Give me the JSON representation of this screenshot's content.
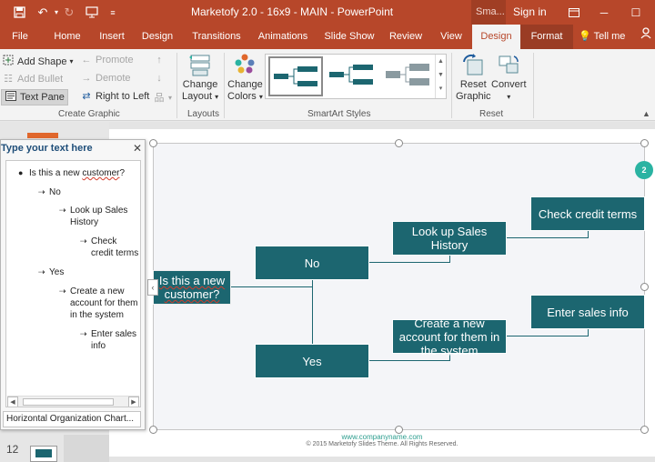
{
  "window": {
    "title": "Marketofy 2.0 - 16x9 - MAIN  -  PowerPoint",
    "context_tab_group": "Sma...",
    "sign_in": "Sign in"
  },
  "tabs": [
    {
      "label": "File"
    },
    {
      "label": "Home"
    },
    {
      "label": "Insert"
    },
    {
      "label": "Design"
    },
    {
      "label": "Transitions"
    },
    {
      "label": "Animations"
    },
    {
      "label": "Slide Show"
    },
    {
      "label": "Review"
    },
    {
      "label": "View"
    },
    {
      "label": "Design"
    },
    {
      "label": "Format"
    },
    {
      "label": "Tell me"
    }
  ],
  "ribbon": {
    "create_graphic": {
      "add_shape": "Add Shape",
      "add_bullet": "Add Bullet",
      "text_pane": "Text Pane",
      "promote": "Promote",
      "demote": "Demote",
      "right_to_left": "Right to Left",
      "label": "Create Graphic"
    },
    "layouts": {
      "change_layout_1": "Change",
      "change_layout_2": "Layout",
      "label": "Layouts"
    },
    "smartart_styles": {
      "change_colors_1": "Change",
      "change_colors_2": "Colors",
      "label": "SmartArt Styles"
    },
    "reset": {
      "reset_graphic_1": "Reset",
      "reset_graphic_2": "Graphic",
      "convert": "Convert",
      "label": "Reset"
    }
  },
  "text_pane": {
    "title": "Type your text here",
    "items": [
      {
        "level": 1,
        "text": "Is this a new customer?"
      },
      {
        "level": 2,
        "text": "No"
      },
      {
        "level": 3,
        "text": "Look up Sales History"
      },
      {
        "level": 4,
        "text": "Check credit terms"
      },
      {
        "level": 2,
        "text": "Yes"
      },
      {
        "level": 3,
        "text": "Create a new account for them in the system"
      },
      {
        "level": 4,
        "text": "Enter sales info"
      }
    ],
    "layout_name": "Horizontal Organization Chart..."
  },
  "diagram": {
    "root": "Is this a new customer?",
    "no": "No",
    "yes": "Yes",
    "look_up": "Look up Sales History",
    "check_credit": "Check credit terms",
    "create_account": "Create a new account for them in the system",
    "enter_sales": "Enter sales info",
    "color": "#1c6670"
  },
  "slide": {
    "footer_url": "www.companyname.com",
    "footer_copy": "© 2015 Marketofy Slides Theme. All Rights Reserved.",
    "badge": "2"
  },
  "status": {
    "slide_number": "12"
  }
}
